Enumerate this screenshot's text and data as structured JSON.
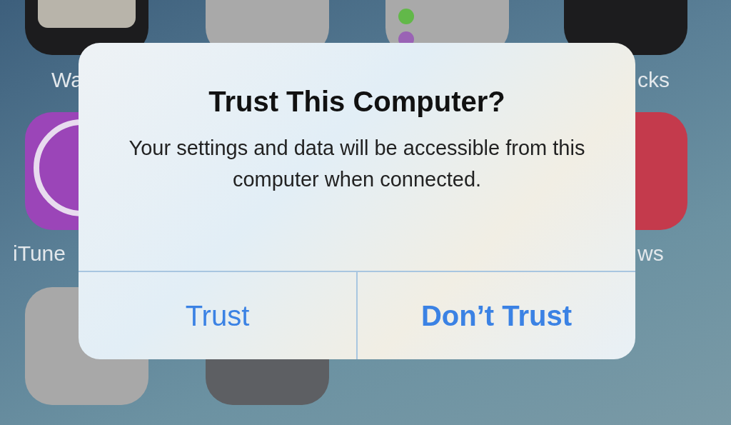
{
  "home_screen": {
    "app_labels": [
      {
        "text": "Wa"
      },
      {
        "text": "cks"
      },
      {
        "text": "iTune"
      },
      {
        "text": "ws"
      }
    ]
  },
  "alert": {
    "title": "Trust This Computer?",
    "message": "Your settings and data will be accessible from this computer when connected.",
    "buttons": [
      {
        "label": "Trust",
        "kind": "default"
      },
      {
        "label": "Don’t Trust",
        "kind": "preferred"
      }
    ]
  }
}
